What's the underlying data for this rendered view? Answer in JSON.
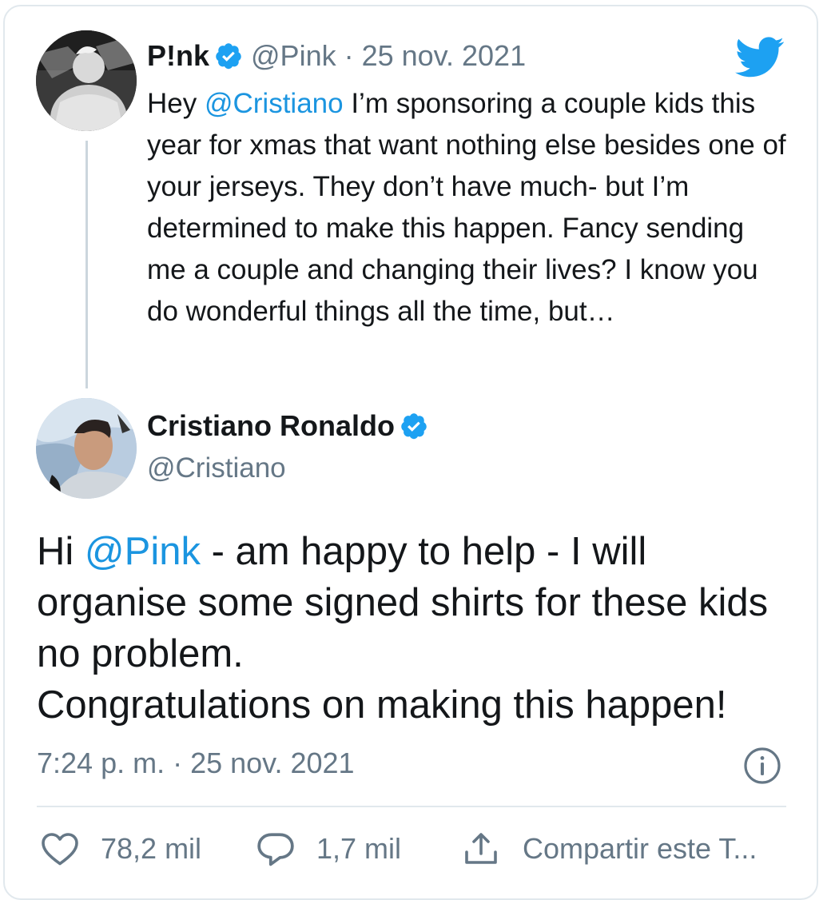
{
  "quoted_tweet": {
    "author_name": "P!nk",
    "handle": "@Pink",
    "date": "· 25 nov. 2021",
    "text_before_mention": "Hey ",
    "mention": "@Cristiano",
    "text_after_mention": " I’m sponsoring a couple kids this year for xmas that want nothing else besides one of your jerseys. They don’t have much- but I’m determined to make this happen. Fancy sending me a couple and changing their lives? I know you do wonderful things all the time, but…"
  },
  "tweet": {
    "author_name": "Cristiano Ronaldo",
    "handle": "@Cristiano",
    "text_before_mention": "Hi ",
    "mention": "@Pink",
    "text_after_mention": " - am happy to help - I will organise some signed shirts for these kids no problem.",
    "text_line2": "Congratulations on making this happen!",
    "timestamp": "7:24 p. m. · 25 nov. 2021"
  },
  "actions": {
    "likes": "78,2 mil",
    "replies": "1,7 mil",
    "share_label": "Compartir este T..."
  },
  "icons": {
    "verified": "verified-badge-icon",
    "brand": "twitter-bird-icon",
    "info": "info-icon",
    "like": "heart-icon",
    "reply": "speech-bubble-icon",
    "share": "share-icon"
  },
  "colors": {
    "accent": "#1da1f2",
    "mention": "#1b95e0",
    "muted": "#657786",
    "text": "#14171a"
  }
}
